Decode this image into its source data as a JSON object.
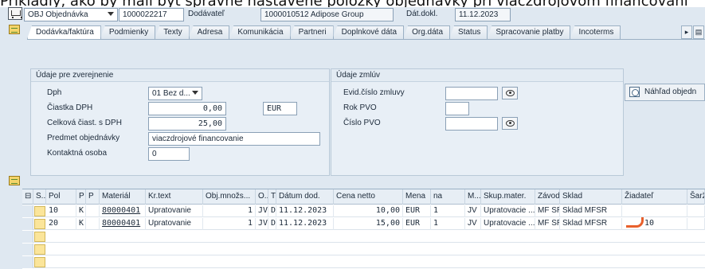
{
  "caption": "Prikladly, ako by mali byt spravne nastavené polozky objednávky pri viaczdrojovom financovaní",
  "header": {
    "doc_type": "OBJ Objednávka",
    "doc_number": "1000022217",
    "supplier_label": "Dodávateľ",
    "supplier_value": "1000010512 Adipose Group",
    "doc_date_label": "Dát.dokl.",
    "doc_date_value": "11.12.2023"
  },
  "tabs": [
    "Dodávka/faktúra",
    "Podmienky",
    "Texty",
    "Adresa",
    "Komunikácia",
    "Partneri",
    "Doplnkové dáta",
    "Org.dáta",
    "Status",
    "Spracovanie platby",
    "Incoterms"
  ],
  "publication": {
    "title": "Údaje pre zverejnenie",
    "dph_label": "Dph",
    "dph_value": "01 Bez d...",
    "vat_amount_label": "Čiastka DPH",
    "vat_amount_value": "0,00",
    "currency": "EUR",
    "total_label": "Celková čiast. s DPH",
    "total_value": "25,00",
    "subject_label": "Predmet objednávky",
    "subject_value": "viaczdrojové financovanie",
    "contact_label": "Kontaktná osoba",
    "contact_value": "0"
  },
  "contracts": {
    "title": "Údaje zmlúv",
    "evid_label": "Evid.číslo zmluvy",
    "year_label": "Rok PVO",
    "pvo_label": "Číslo PVO"
  },
  "preview_button": "Náhľad objedn",
  "table": {
    "headers": [
      "S..",
      "Pol",
      "P",
      "P",
      "Materiál",
      "Kr.text",
      "Obj.množs...",
      "O...",
      "T",
      "Dátum dod.",
      "Cena netto",
      "Mena",
      "na",
      "M...",
      "Skup.mater.",
      "Závod",
      "Sklad",
      "Žiadateľ",
      "Šarža"
    ],
    "rows": [
      {
        "pol": "10",
        "p": "K",
        "material": "80000401",
        "text": "Upratovanie",
        "qty": "1",
        "unit": "JV",
        "t": "D",
        "date": "11.12.2023",
        "price": "10,00",
        "currency": "EUR",
        "per": "1",
        "m": "JV",
        "group": "Upratovacie ...",
        "plant": "MF SR",
        "store": "Sklad MFSR",
        "requester": ""
      },
      {
        "pol": "20",
        "p": "K",
        "material": "80000401",
        "text": "Upratovanie",
        "qty": "1",
        "unit": "JV",
        "t": "D",
        "date": "11.12.2023",
        "price": "15,00",
        "currency": "EUR",
        "per": "1",
        "m": "JV",
        "group": "Upratovacie ...",
        "plant": "MF SR",
        "store": "Sklad MFSR",
        "requester": "10"
      }
    ]
  },
  "colors": {
    "annotation": "#e8602c",
    "background": "#dfe8f1"
  }
}
